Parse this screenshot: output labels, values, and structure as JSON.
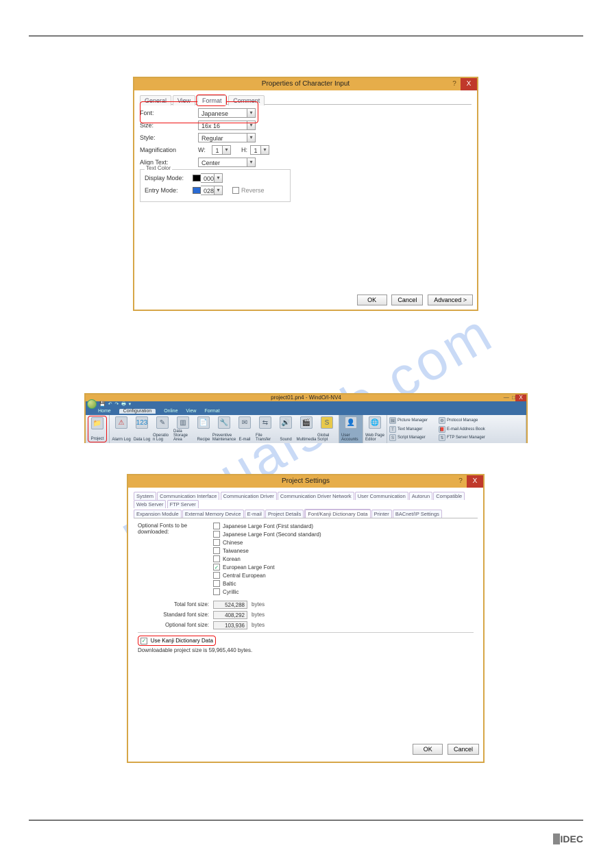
{
  "watermark": "manualslib.com",
  "logo": "IDEC",
  "dialog1": {
    "title": "Properties of Character Input",
    "tabs": {
      "general": "General",
      "view": "View",
      "format": "Format",
      "comment": "Comment"
    },
    "font_label": "Font:",
    "font_value": "Japanese",
    "size_label": "Size:",
    "size_value": "16x 16",
    "style_label": "Style:",
    "style_value": "Regular",
    "mag_label": "Magnification",
    "mag_w": "W:",
    "mag_w_v": "1",
    "mag_h": "H:",
    "mag_h_v": "1",
    "align_label": "Align Text:",
    "align_value": "Center",
    "group_legend": "Text Color",
    "display_mode": "Display Mode:",
    "display_val": "000",
    "entry_mode": "Entry Mode:",
    "entry_val": "028",
    "reverse": "Reverse",
    "btn_ok": "OK",
    "btn_cancel": "Cancel",
    "btn_adv": "Advanced >"
  },
  "ribbon": {
    "title": "project01.pn4 - WindO/I-NV4",
    "tabs": {
      "home": "Home",
      "config": "Configuration",
      "online": "Online",
      "view": "View",
      "format": "Format"
    },
    "project": "Project",
    "alarm": "Alarm Log",
    "datalog": "Data Log",
    "oplog": "Operatio n Log",
    "dstore": "Data Storage Area",
    "recipe": "Recipe",
    "prevm": "Preventive Maintenance",
    "email": "E-mail",
    "filet": "File Transfer",
    "sound": "Sound",
    "media": "Multimedia",
    "gscript": "Global Script",
    "uacct": "User Accounts",
    "webpage": "Web Page Editor",
    "picman": "Picture Manager",
    "textman": "Text Manager",
    "scriptman": "Script Manager",
    "protoman": "Protocol Manage",
    "emailbook": "E-mail Address Book",
    "ftpman": "FTP Server Manager"
  },
  "dialog2": {
    "title": "Project Settings",
    "tabs1": [
      "System",
      "Communication Interface",
      "Communication Driver",
      "Communication Driver Network",
      "User Communication",
      "Autorun",
      "Compatible",
      "Web Server",
      "FTP Server"
    ],
    "tabs2": [
      "Expansion Module",
      "External Memory Device",
      "E-mail",
      "Project Details",
      "Font/Kanji Dictionary Data",
      "Printer",
      "BACnet/IP Settings"
    ],
    "fonts_label": "Optional Fonts to be downloaded:",
    "fonts": {
      "jp1": "Japanese Large Font (First standard)",
      "jp2": "Japanese Large Font (Second standard)",
      "cn": "Chinese",
      "tw": "Taiwanese",
      "kr": "Korean",
      "euro": "European Large Font",
      "ce": "Central European",
      "baltic": "Baltic",
      "cyr": "Cyrillic"
    },
    "total_label": "Total font size:",
    "total_val": "524,288",
    "std_label": "Standard font size:",
    "std_val": "408,292",
    "opt_label": "Optional font size:",
    "opt_val": "103,936",
    "bytes": "bytes",
    "kanji": "Use Kanji Dictionary Data",
    "dl_note": "Downloadable project size is 59,965,440 bytes.",
    "btn_ok": "OK",
    "btn_cancel": "Cancel"
  }
}
